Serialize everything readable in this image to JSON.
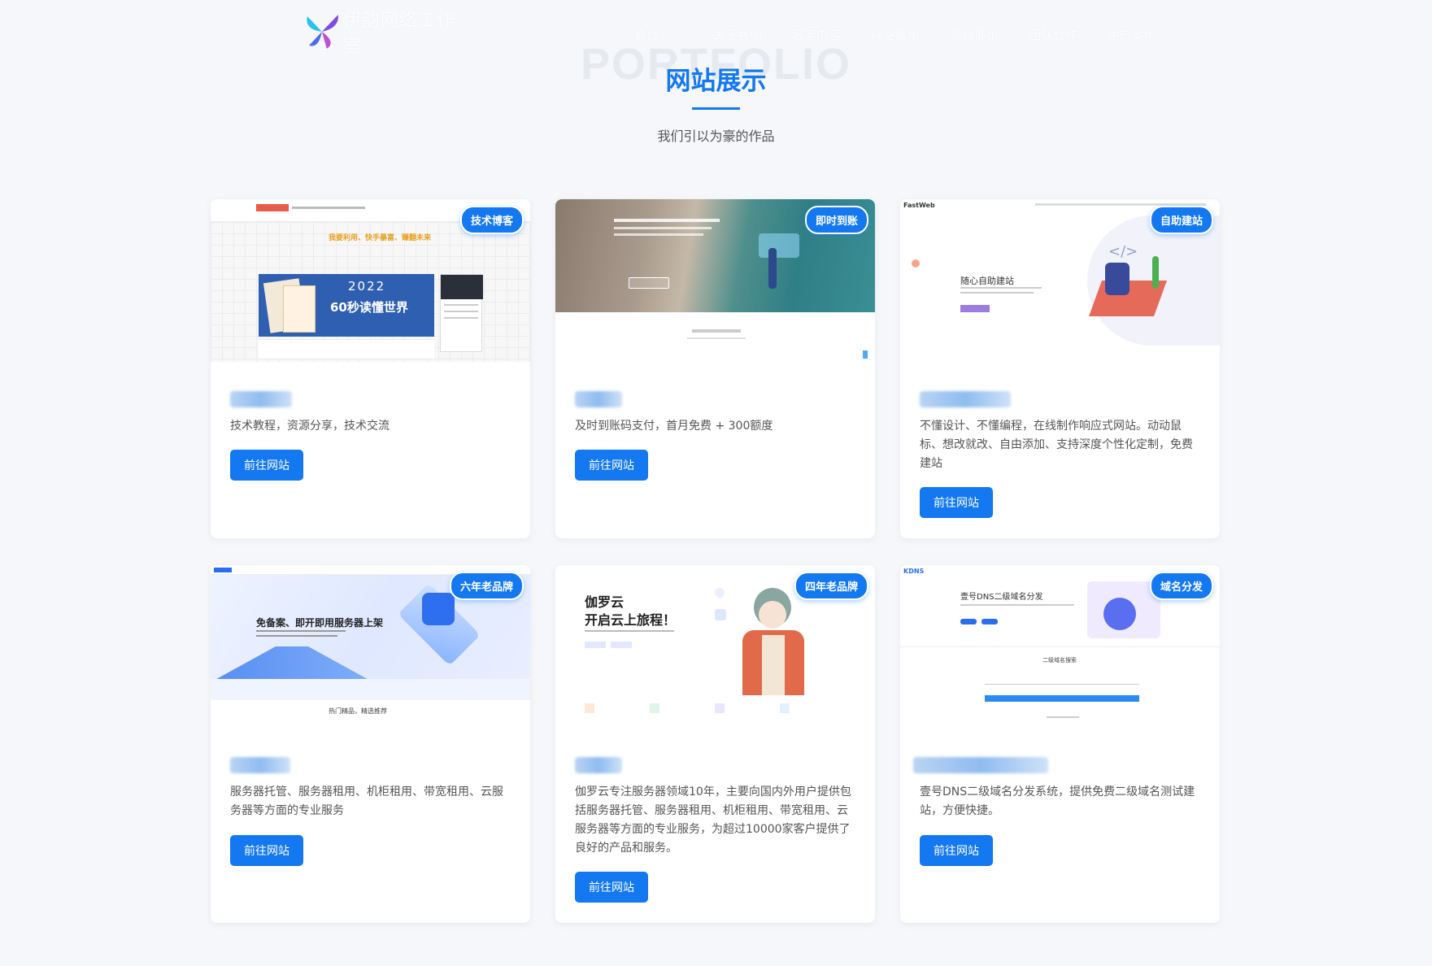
{
  "header": {
    "logo_text": "伊韵网络工作室",
    "logo_subtext": "YIYUN NETWORK STUDIO",
    "nav": [
      "首页",
      "关于我们",
      "服务内容",
      "网站展示",
      "项目展示",
      "团队合作",
      "用户案例"
    ]
  },
  "section": {
    "bg_word": "PORTFOLIO",
    "title": "网站展示",
    "subtitle": "我们引以为豪的作品"
  },
  "cards": [
    {
      "badge": "技术博客",
      "desc": "技术教程，资源分享，技术交流",
      "button": "前往网站",
      "thumb": {
        "banner_year": "2022",
        "banner_text": "60秒读懂世界",
        "slogan": "我要利用、快手暴富、赚翻未来"
      }
    },
    {
      "badge": "即时到账",
      "desc": "及时到账码支付，首月免费 + 300额度",
      "button": "前往网站",
      "thumb": {}
    },
    {
      "badge": "自助建站",
      "desc": "不懂设计、不懂编程，在线制作响应式网站。动动鼠标、想改就改、自由添加、支持深度个性化定制，免费建站",
      "button": "前往网站",
      "thumb": {
        "brand": "FastWeb",
        "heading": "随心自助建站"
      }
    },
    {
      "badge": "六年老品牌",
      "desc": "服务器托管、服务器租用、机柜租用、带宽租用、云服务器等方面的专业服务",
      "button": "前往网站",
      "thumb": {
        "heading": "免备案、即开即用服务器上架",
        "footer": "热门精品，精选推荐"
      }
    },
    {
      "badge": "四年老品牌",
      "desc": "伽罗云专注服务器领域10年，主要向国内外用户提供包括服务器托管、服务器租用、机柜租用、带宽租用、云服务器等方面的专业服务，为超过10000家客户提供了良好的产品和服务。",
      "button": "前往网站",
      "thumb": {
        "heading1": "伽罗云",
        "heading2": "开启云上旅程！"
      }
    },
    {
      "badge": "域名分发",
      "desc": "壹号DNS二级域名分发系统，提供免费二级域名测试建站，方便快捷。",
      "button": "前往网站",
      "thumb": {
        "brand": "KDNS",
        "heading": "壹号DNS二级域名分发",
        "sub": "二级域名搜索"
      }
    }
  ],
  "colors": {
    "accent": "#1478f0",
    "bg": "#f5f7fa"
  }
}
